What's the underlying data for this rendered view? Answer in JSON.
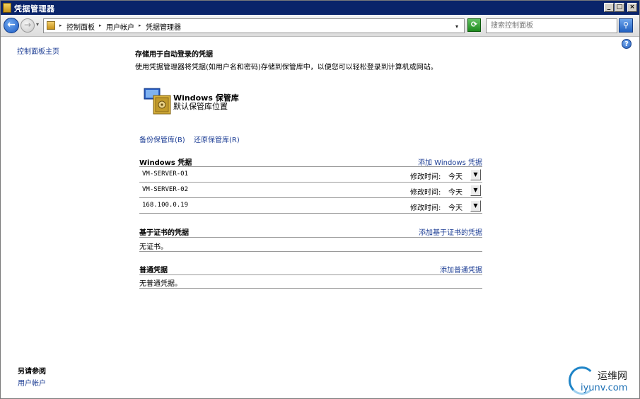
{
  "window": {
    "title": "凭据管理器",
    "min_icon": "_",
    "max_icon": "□",
    "close_icon": "×"
  },
  "addressbar": {
    "back_glyph": "←",
    "forward_glyph": "→",
    "dropdown_glyph": "▾",
    "crumbs": [
      "控制面板",
      "用户帐户",
      "凭据管理器"
    ],
    "crumb_sep": "▸",
    "refresh_glyph": "⟳",
    "search_placeholder": "搜索控制面板",
    "search_glyph": "⚲"
  },
  "left_pane": {
    "home_link": "控制面板主页",
    "see_also_title": "另请参阅",
    "see_also_link": "用户帐户"
  },
  "help_glyph": "?",
  "main": {
    "title": "存储用于自动登录的凭据",
    "description": "使用凭据管理器将凭据(如用户名和密码)存储到保管库中，以便您可以轻松登录到计算机或网站。",
    "vault": {
      "title": "Windows 保管库",
      "subtitle": "默认保管库位置"
    },
    "backup_link": "备份保管库(B)",
    "restore_link": "还原保管库(R)",
    "windows_section": {
      "title": "Windows 凭据",
      "add_link": "添加 Windows 凭据",
      "rows": [
        {
          "name": "VM-SERVER-01",
          "modified_label": "修改时间:",
          "modified_value": "今天",
          "expand": "▼"
        },
        {
          "name": "VM-SERVER-02",
          "modified_label": "修改时间:",
          "modified_value": "今天",
          "expand": "▼"
        },
        {
          "name": "168.100.0.19",
          "modified_label": "修改时间:",
          "modified_value": "今天",
          "expand": "▼"
        }
      ]
    },
    "cert_section": {
      "title": "基于证书的凭据",
      "add_link": "添加基于证书的凭据",
      "empty": "无证书。"
    },
    "generic_section": {
      "title": "普通凭据",
      "add_link": "添加普通凭据",
      "empty": "无普通凭据。"
    }
  },
  "watermark": {
    "cn": "运维网",
    "url": "iyunv.com"
  }
}
